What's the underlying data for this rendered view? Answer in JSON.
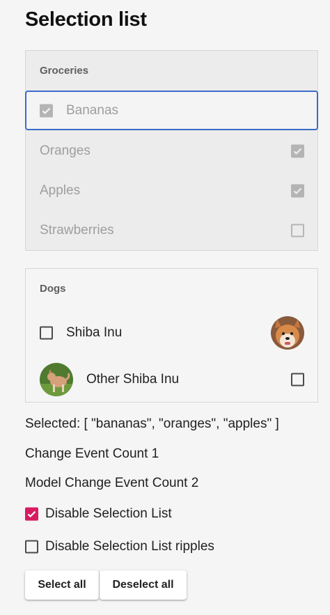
{
  "page": {
    "title": "Selection list"
  },
  "groceries": {
    "header": "Groceries",
    "items": [
      {
        "label": "Bananas",
        "checked": true
      },
      {
        "label": "Oranges",
        "checked": true
      },
      {
        "label": "Apples",
        "checked": true
      },
      {
        "label": "Strawberries",
        "checked": false
      }
    ]
  },
  "dogs": {
    "header": "Dogs",
    "items": [
      {
        "label": "Shiba Inu",
        "checked": false
      },
      {
        "label": "Other Shiba Inu",
        "checked": false
      }
    ]
  },
  "status": {
    "selected": "Selected: [ \"bananas\", \"oranges\", \"apples\" ]",
    "change_count": "Change Event Count 1",
    "model_change_count": "Model Change Event Count 2"
  },
  "options": {
    "disable_list": {
      "label": "Disable Selection List",
      "checked": true
    },
    "disable_ripples": {
      "label": "Disable Selection List ripples",
      "checked": false
    }
  },
  "buttons": {
    "select_all": "Select all",
    "deselect_all": "Deselect all"
  },
  "colors": {
    "accent": "#d81b60",
    "focus": "#3b6bc9"
  }
}
